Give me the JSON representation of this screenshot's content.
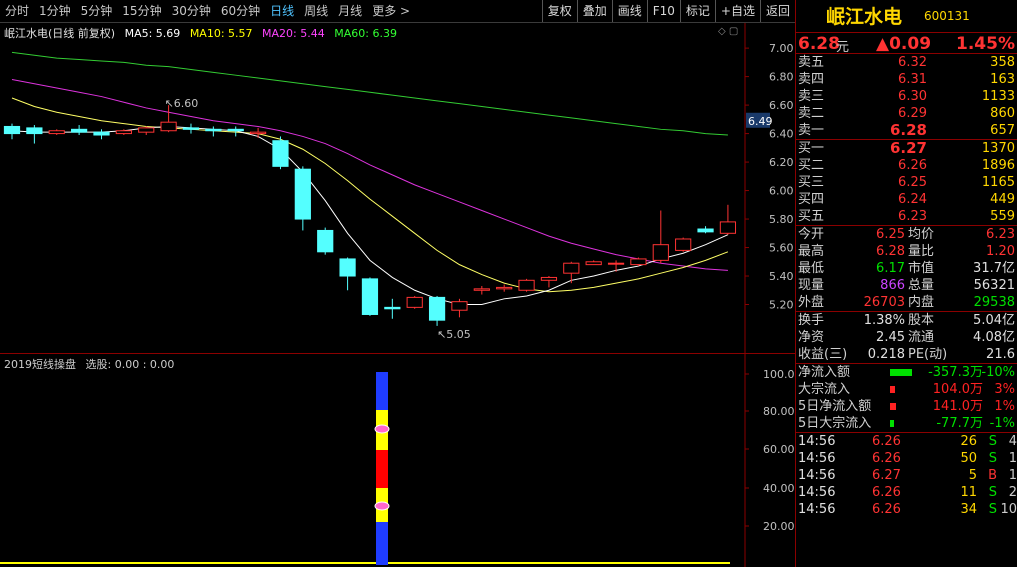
{
  "toolbar": {
    "periods": [
      "分时",
      "1分钟",
      "5分钟",
      "15分钟",
      "30分钟",
      "60分钟",
      "日线",
      "周线",
      "月线",
      "更多 >"
    ],
    "active_period": "日线",
    "buttons": [
      "复权",
      "叠加",
      "画线",
      "F10",
      "标记",
      "+自选",
      "返回"
    ]
  },
  "chart": {
    "title": "岷江水电(日线 前复权)",
    "ma5": "MA5: 5.69",
    "ma10": "MA10: 5.57",
    "ma20": "MA20: 5.44",
    "ma60": "MA60: 6.39",
    "current_price_tag": "6.49",
    "high_marker": "6.60",
    "low_marker": "5.05",
    "colors": {
      "ma5": "#ffffff",
      "ma10": "#ffff00",
      "ma20": "#ff00ff",
      "ma60": "#00ff00",
      "up": "#ff3333",
      "down": "#54ffff"
    }
  },
  "indicator": {
    "title": "2019短线操盘",
    "legend": "选股: 0.00 : 0.00",
    "axis": [
      "100.0",
      "80.00",
      "60.00",
      "40.00",
      "20.00"
    ]
  },
  "chart_data": {
    "type": "candlestick",
    "ylim": [
      5.0,
      7.05
    ],
    "y_ticks": [
      "7.00",
      "6.80",
      "6.60",
      "6.40",
      "6.20",
      "6.00",
      "5.80",
      "5.60",
      "5.40",
      "5.20"
    ],
    "candles": [
      [
        6.45,
        6.4,
        6.47,
        6.36
      ],
      [
        6.44,
        6.4,
        6.46,
        6.33
      ],
      [
        6.4,
        6.42,
        6.43,
        6.39
      ],
      [
        6.43,
        6.41,
        6.46,
        6.39
      ],
      [
        6.41,
        6.39,
        6.43,
        6.36
      ],
      [
        6.4,
        6.42,
        6.43,
        6.39
      ],
      [
        6.41,
        6.44,
        6.45,
        6.39
      ],
      [
        6.42,
        6.48,
        6.6,
        6.41
      ],
      [
        6.44,
        6.43,
        6.47,
        6.4
      ],
      [
        6.43,
        6.42,
        6.45,
        6.38
      ],
      [
        6.43,
        6.42,
        6.45,
        6.38
      ],
      [
        6.4,
        6.41,
        6.44,
        6.37
      ],
      [
        6.35,
        6.17,
        6.38,
        6.15
      ],
      [
        6.15,
        5.8,
        6.17,
        5.72
      ],
      [
        5.72,
        5.57,
        5.74,
        5.55
      ],
      [
        5.52,
        5.4,
        5.53,
        5.3
      ],
      [
        5.38,
        5.13,
        5.39,
        5.12
      ],
      [
        5.18,
        5.17,
        5.24,
        5.1
      ],
      [
        5.18,
        5.25,
        5.26,
        5.17
      ],
      [
        5.25,
        5.09,
        5.26,
        5.05
      ],
      [
        5.16,
        5.22,
        5.24,
        5.11
      ],
      [
        5.3,
        5.31,
        5.33,
        5.27
      ],
      [
        5.31,
        5.32,
        5.34,
        5.29
      ],
      [
        5.3,
        5.37,
        5.38,
        5.29
      ],
      [
        5.37,
        5.39,
        5.4,
        5.32
      ],
      [
        5.42,
        5.49,
        5.5,
        5.35
      ],
      [
        5.48,
        5.5,
        5.51,
        5.48
      ],
      [
        5.49,
        5.49,
        5.51,
        5.43
      ],
      [
        5.48,
        5.52,
        5.53,
        5.47
      ],
      [
        5.51,
        5.62,
        5.86,
        5.49
      ],
      [
        5.58,
        5.66,
        5.67,
        5.57
      ],
      [
        5.73,
        5.71,
        5.75,
        5.7
      ],
      [
        5.7,
        5.78,
        5.9,
        5.69
      ]
    ],
    "ma5": [
      6.42,
      6.41,
      6.41,
      6.41,
      6.41,
      6.42,
      6.44,
      6.45,
      6.44,
      6.43,
      6.42,
      6.38,
      6.29,
      6.13,
      5.93,
      5.7,
      5.51,
      5.39,
      5.3,
      5.24,
      5.2,
      5.2,
      5.24,
      5.26,
      5.3,
      5.37,
      5.4,
      5.44,
      5.47,
      5.52,
      5.56,
      5.62,
      5.69
    ],
    "ma10": [
      6.65,
      6.59,
      6.55,
      6.52,
      6.49,
      6.47,
      6.45,
      6.44,
      6.43,
      6.42,
      6.41,
      6.4,
      6.36,
      6.29,
      6.19,
      6.07,
      5.94,
      5.82,
      5.7,
      5.58,
      5.48,
      5.41,
      5.35,
      5.31,
      5.29,
      5.3,
      5.32,
      5.35,
      5.38,
      5.42,
      5.46,
      5.51,
      5.57
    ],
    "ma20": [
      6.78,
      6.75,
      6.72,
      6.69,
      6.66,
      6.62,
      6.58,
      6.55,
      6.52,
      6.49,
      6.47,
      6.45,
      6.42,
      6.38,
      6.33,
      6.26,
      6.18,
      6.11,
      6.04,
      5.98,
      5.92,
      5.86,
      5.8,
      5.74,
      5.68,
      5.63,
      5.59,
      5.55,
      5.52,
      5.49,
      5.47,
      5.45,
      5.44
    ],
    "ma60": [
      6.97,
      6.95,
      6.93,
      6.92,
      6.91,
      6.9,
      6.88,
      6.87,
      6.85,
      6.83,
      6.81,
      6.79,
      6.77,
      6.75,
      6.73,
      6.71,
      6.69,
      6.67,
      6.65,
      6.63,
      6.61,
      6.59,
      6.57,
      6.55,
      6.53,
      6.51,
      6.49,
      6.47,
      6.45,
      6.43,
      6.42,
      6.4,
      6.39
    ]
  },
  "quote": {
    "name": "岷江水电",
    "code": "600131",
    "price": "6.28",
    "price_unit": "元",
    "change": "▲0.09",
    "change_pct": "1.45%",
    "asks": [
      {
        "label": "卖五",
        "price": "6.32",
        "vol": "358"
      },
      {
        "label": "卖四",
        "price": "6.31",
        "vol": "163"
      },
      {
        "label": "卖三",
        "price": "6.30",
        "vol": "1133"
      },
      {
        "label": "卖二",
        "price": "6.29",
        "vol": "860"
      },
      {
        "label": "卖一",
        "price": "6.28",
        "vol": "657"
      }
    ],
    "bids": [
      {
        "label": "买一",
        "price": "6.27",
        "vol": "1370"
      },
      {
        "label": "买二",
        "price": "6.26",
        "vol": "1896"
      },
      {
        "label": "买三",
        "price": "6.25",
        "vol": "1165"
      },
      {
        "label": "买四",
        "price": "6.24",
        "vol": "449"
      },
      {
        "label": "买五",
        "price": "6.23",
        "vol": "559"
      }
    ],
    "stats": [
      {
        "l1": "今开",
        "v1": "6.25",
        "l2": "均价",
        "v2": "6.23"
      },
      {
        "l1": "最高",
        "v1": "6.28",
        "l2": "量比",
        "v2": "1.20"
      },
      {
        "l1": "最低",
        "v1": "6.17",
        "l2": "市值",
        "v2": "31.7亿"
      },
      {
        "l1": "现量",
        "v1": "866",
        "l2": "总量",
        "v2": "56321"
      },
      {
        "l1": "外盘",
        "v1": "26703",
        "l2": "内盘",
        "v2": "29538"
      }
    ],
    "fund": [
      {
        "l1": "换手",
        "v1": "1.38%",
        "l2": "股本",
        "v2": "5.04亿"
      },
      {
        "l1": "净资",
        "v1": "2.45",
        "l2": "流通",
        "v2": "4.08亿"
      },
      {
        "l1": "收益(三)",
        "v1": "0.218",
        "l2": "PE(动)",
        "v2": "21.6"
      }
    ],
    "flows": [
      {
        "label": "净流入额",
        "value": "-357.3万",
        "pct": "-10%"
      },
      {
        "label": "大宗流入",
        "value": "104.0万",
        "pct": "3%"
      },
      {
        "label": "5日净流入额",
        "value": "141.0万",
        "pct": "1%"
      },
      {
        "label": "5日大宗流入",
        "value": "-77.7万",
        "pct": "-1%"
      }
    ],
    "ticks": [
      {
        "time": "14:56",
        "price": "6.26",
        "vol": "26",
        "side": "S",
        "n": "4"
      },
      {
        "time": "14:56",
        "price": "6.26",
        "vol": "50",
        "side": "S",
        "n": "1"
      },
      {
        "time": "14:56",
        "price": "6.27",
        "vol": "5",
        "side": "B",
        "n": "1"
      },
      {
        "time": "14:56",
        "price": "6.26",
        "vol": "11",
        "side": "S",
        "n": "2"
      },
      {
        "time": "14:56",
        "price": "6.26",
        "vol": "34",
        "side": "S",
        "n": "10"
      }
    ]
  }
}
